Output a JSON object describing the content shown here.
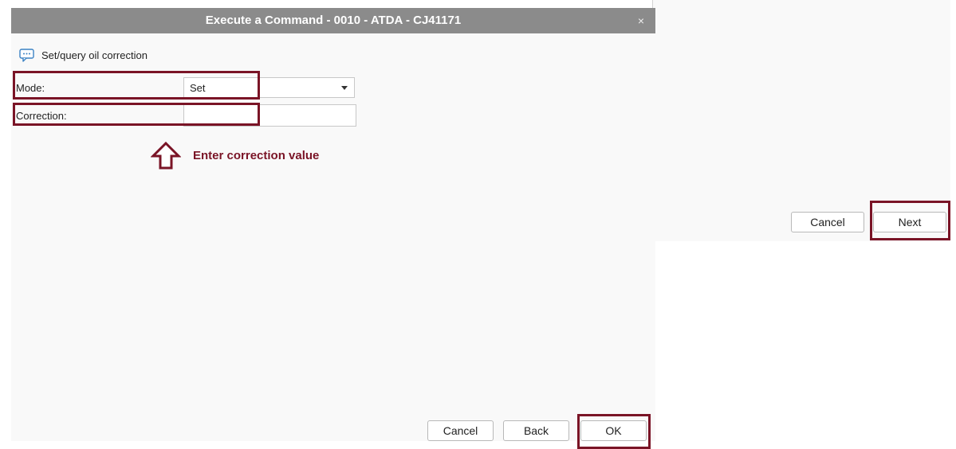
{
  "dialog": {
    "title": "Execute a Command - 0010 - ATDA - CJ41171",
    "close_glyph": "×",
    "command_icon": "chat-ellipsis-icon",
    "command_title": "Set/query oil correction",
    "mode_label": "Mode:",
    "mode_value": "Set",
    "correction_label": "Correction:",
    "correction_value": "",
    "annotation": "Enter correction value",
    "buttons": {
      "cancel": "Cancel",
      "back": "Back",
      "ok": "OK"
    }
  },
  "background_dialog": {
    "buttons": {
      "cancel": "Cancel",
      "next": "Next"
    }
  },
  "colors": {
    "title_bar": "#8b8b8b",
    "highlight": "#7a1426",
    "dialog_bg": "#f9f9f9",
    "icon_blue": "#3b82c4"
  }
}
